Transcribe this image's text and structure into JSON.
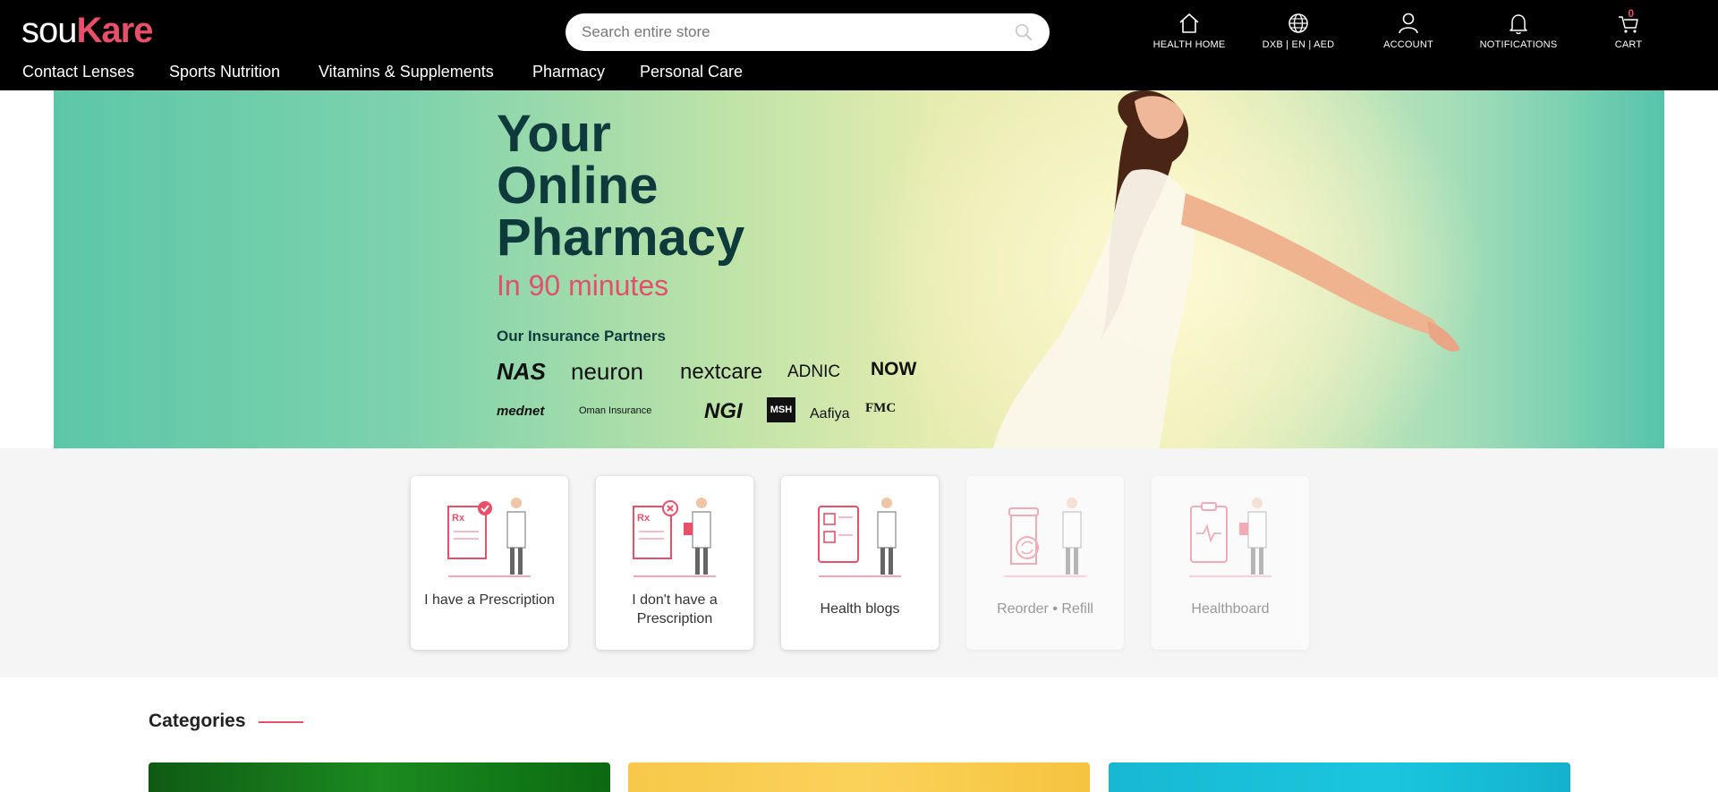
{
  "header": {
    "logo_part1": "sou",
    "logo_part2": "Kare",
    "search_placeholder": "Search entire store",
    "nav": [
      {
        "label": "HEALTH HOME",
        "icon": "home-icon"
      },
      {
        "label": "DXB | EN | AED",
        "icon": "globe-icon"
      },
      {
        "label": "ACCOUNT",
        "icon": "user-icon"
      },
      {
        "label": "NOTIFICATIONS",
        "icon": "bell-icon"
      },
      {
        "label": "CART",
        "icon": "cart-icon",
        "count": "0"
      }
    ],
    "menu": [
      "Contact Lenses",
      "Sports Nutrition",
      "Vitamins & Supplements",
      "Pharmacy",
      "Personal Care"
    ]
  },
  "hero": {
    "title_line1": "Your",
    "title_line2": "Online",
    "title_line3": "Pharmacy",
    "subtitle": "In 90 minutes",
    "partners_heading": "Our Insurance Partners",
    "partners": [
      "NAS",
      "neuron",
      "nextcare",
      "ADNIC",
      "NOW",
      "mednet",
      "Oman Insurance",
      "NGI",
      "MSH",
      "Aafiya",
      "FMC"
    ]
  },
  "cards": [
    {
      "label": "I have a Prescription",
      "active": true
    },
    {
      "label": "I don't have a Prescription",
      "active": true
    },
    {
      "label": "Health blogs",
      "active": true
    },
    {
      "label": "Reorder • Refill",
      "active": false
    },
    {
      "label": "Healthboard",
      "active": false
    }
  ],
  "categories": {
    "title": "Categories"
  },
  "colors": {
    "brand_pink": "#e8506a",
    "header_bg": "#000000",
    "hero_title": "#0f3a3c"
  }
}
